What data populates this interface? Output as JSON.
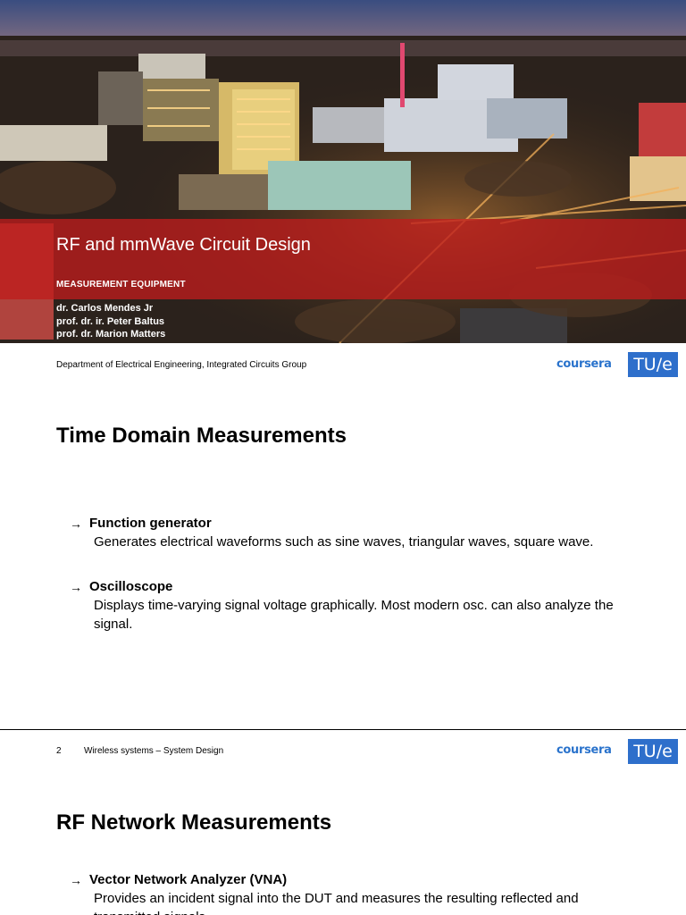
{
  "title_slide": {
    "title": "RF and mmWave Circuit Design",
    "subtitle": "MEASUREMENT EQUIPMENT",
    "authors": [
      "dr. Carlos Mendes Jr",
      "prof. dr. ir. Peter Baltus",
      "prof. dr. Marion Matters"
    ],
    "department": "Department of Electrical Engineering, Integrated Circuits Group"
  },
  "brand": {
    "coursera": "coursera",
    "tue": "TU/e",
    "coursera_color": "#2a73cc",
    "tue_color": "#2e6fcb",
    "band_color": "#be1c1c"
  },
  "slide_2": {
    "title": "Time Domain Measurements",
    "bullets": [
      {
        "head": "Function generator",
        "desc": "Generates electrical waveforms such as sine waves, triangular waves, square wave."
      },
      {
        "head": "Oscilloscope",
        "desc": "Displays time-varying signal voltage graphically. Most modern osc. can also analyze the signal."
      }
    ],
    "page_number": "2",
    "footer": "Wireless systems –  System Design"
  },
  "slide_3": {
    "title": "RF Network Measurements",
    "bullets": [
      {
        "head": "Vector Network Analyzer (VNA)",
        "desc": "Provides an incident signal into the DUT and measures the resulting reflected and transmitted signals."
      }
    ]
  },
  "icons": {
    "bullet": "arrow-right-icon"
  }
}
